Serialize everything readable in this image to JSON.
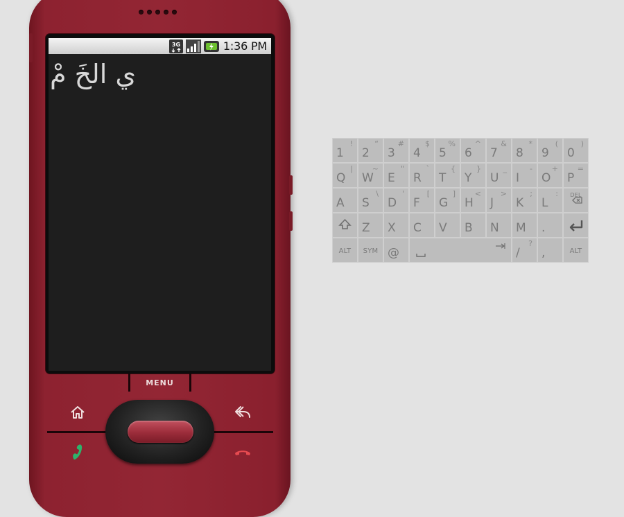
{
  "status_bar": {
    "network_badge": "3G",
    "time": "1:36 PM",
    "icons": [
      "3g-data-icon",
      "signal-strength-icon",
      "battery-charging-icon"
    ]
  },
  "screen": {
    "text": "ي الخَ مْ"
  },
  "hardware": {
    "menu_label": "MENU",
    "buttons": [
      "home-icon",
      "back-icon",
      "call-icon",
      "end-call-icon"
    ]
  },
  "keyboard": {
    "rows": [
      [
        {
          "main": "1",
          "alt": "!"
        },
        {
          "main": "2",
          "alt": "“"
        },
        {
          "main": "3",
          "alt": "#"
        },
        {
          "main": "4",
          "alt": "$"
        },
        {
          "main": "5",
          "alt": "%"
        },
        {
          "main": "6",
          "alt": "^"
        },
        {
          "main": "7",
          "alt": "&"
        },
        {
          "main": "8",
          "alt": "*"
        },
        {
          "main": "9",
          "alt": "("
        },
        {
          "main": "0",
          "alt": ")"
        }
      ],
      [
        {
          "main": "Q",
          "alt": "|"
        },
        {
          "main": "W",
          "alt": "~"
        },
        {
          "main": "E",
          "alt": "\""
        },
        {
          "main": "R",
          "alt": "`"
        },
        {
          "main": "T",
          "alt": "{"
        },
        {
          "main": "Y",
          "alt": "}"
        },
        {
          "main": "U",
          "alt": "_"
        },
        {
          "main": "I",
          "alt": "-"
        },
        {
          "main": "O",
          "alt": "+"
        },
        {
          "main": "P",
          "alt": "="
        }
      ],
      [
        {
          "main": "A",
          "alt": ""
        },
        {
          "main": "S",
          "alt": "\\"
        },
        {
          "main": "D",
          "alt": "'"
        },
        {
          "main": "F",
          "alt": "["
        },
        {
          "main": "G",
          "alt": "]"
        },
        {
          "main": "H",
          "alt": "<"
        },
        {
          "main": "J",
          "alt": ">"
        },
        {
          "main": "K",
          "alt": ";"
        },
        {
          "main": "L",
          "alt": ":"
        },
        {
          "main": "DEL",
          "alt": ""
        }
      ],
      [
        {
          "main": "shift",
          "alt": ""
        },
        {
          "main": "Z",
          "alt": ""
        },
        {
          "main": "X",
          "alt": ""
        },
        {
          "main": "C",
          "alt": ""
        },
        {
          "main": "V",
          "alt": ""
        },
        {
          "main": "B",
          "alt": ""
        },
        {
          "main": "N",
          "alt": ""
        },
        {
          "main": "M",
          "alt": ""
        },
        {
          "main": ".",
          "alt": ""
        },
        {
          "main": "enter",
          "alt": ""
        }
      ],
      [
        {
          "main": "ALT",
          "alt": ""
        },
        {
          "main": "SYM",
          "alt": ""
        },
        {
          "main": "@",
          "alt": ""
        },
        {
          "main": "space",
          "alt": ""
        },
        {
          "main": "/",
          "alt": "?"
        },
        {
          "main": ",",
          "alt": ""
        },
        {
          "main": "ALT",
          "alt": ""
        }
      ]
    ]
  }
}
